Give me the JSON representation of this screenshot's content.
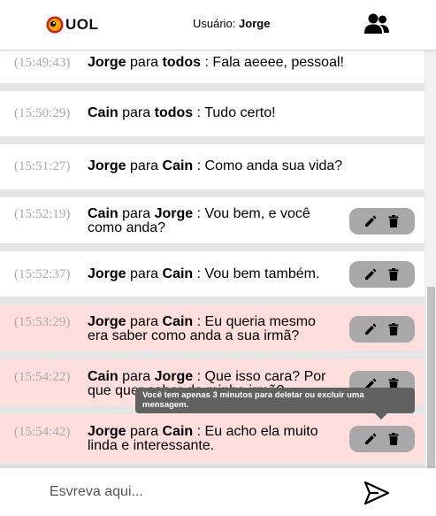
{
  "header": {
    "logo_text": "UOL",
    "user_prefix": "Usuário:",
    "user_name": "Jorge",
    "participants_icon": "people-icon"
  },
  "messages": [
    {
      "time": "(15:49:43)",
      "from": "Jorge",
      "connector": "para",
      "to": "todos",
      "separator": ":",
      "text_line1": "Fala aeeee, pessoal!",
      "text_line2": "",
      "private": false,
      "editable": false
    },
    {
      "time": "(15:50:29)",
      "from": "Cain",
      "connector": "para",
      "to": "todos",
      "separator": ":",
      "text_line1": "Tudo certo!",
      "text_line2": "",
      "private": false,
      "editable": false
    },
    {
      "time": "(15:51:27)",
      "from": "Jorge",
      "connector": "para",
      "to": "Cain",
      "separator": ":",
      "text_line1": "Como anda sua vida?",
      "text_line2": "",
      "private": false,
      "editable": false
    },
    {
      "time": "(15:52:19)",
      "from": "Cain",
      "connector": "para",
      "to": "Jorge",
      "separator": ":",
      "text_line1": "Vou bem, e você",
      "text_line2": "como anda?",
      "private": false,
      "editable": true
    },
    {
      "time": "(15:52:37)",
      "from": "Jorge",
      "connector": "para",
      "to": "Cain",
      "separator": ":",
      "text_line1": "Vou bem também.",
      "text_line2": "",
      "private": false,
      "editable": true
    },
    {
      "time": "(15:53:29)",
      "from": "Jorge",
      "connector": "para",
      "to": "Cain",
      "separator": ":",
      "text_line1": "Eu queria mesmo",
      "text_line2": "era saber como anda a sua irmã?",
      "private": true,
      "editable": true
    },
    {
      "time": "(15:54:22)",
      "from": "Cain",
      "connector": "para",
      "to": "Jorge",
      "separator": ":",
      "text_line1": "Que isso cara? Por",
      "text_line2": "que quer saber da minha irmã?",
      "private": true,
      "editable": true
    },
    {
      "time": "(15:54:42)",
      "from": "Jorge",
      "connector": "para",
      "to": "Cain",
      "separator": ":",
      "text_line1": "Eu acho ela muito",
      "text_line2": "linda e interessante.",
      "private": true,
      "editable": true
    }
  ],
  "actions": {
    "edit_icon": "pencil-icon",
    "delete_icon": "trash-icon"
  },
  "tooltip": {
    "text": "Você tem apenas 3 minutos para deletar ou excluir uma mensagem."
  },
  "footer": {
    "input_placeholder": "Esvreva aqui...",
    "input_value": "",
    "send_icon": "send-icon"
  },
  "colors": {
    "private_bg": "#ffdede",
    "public_bg": "#ffffff",
    "chat_bg": "#e5e5e5",
    "action_bg": "#a8a8a8",
    "tooltip_bg": "#616161",
    "logo_yellow": "#f5a800",
    "logo_red": "#d01c1c"
  }
}
